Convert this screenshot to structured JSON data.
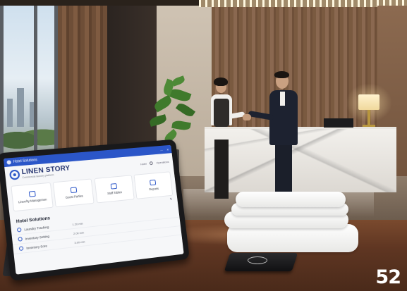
{
  "app": {
    "window_title": "Hotel Solutions",
    "brand": "LINEN STORY",
    "tagline": "Commercial laundry platform",
    "header_links": [
      "Hotel",
      "Operations"
    ]
  },
  "tiles": [
    {
      "label": "Linen/ity Managemen",
      "icon": "washer-icon"
    },
    {
      "label": "Guest Parties",
      "icon": "cart-icon"
    },
    {
      "label": "Staff Tables",
      "icon": "people-icon"
    },
    {
      "label": "Reports",
      "icon": "chart-icon"
    }
  ],
  "section_title": "Hotel Solutions",
  "solutions": [
    {
      "label": "Laundry Tracking",
      "value": "1.20 min",
      "icon": "truck-icon"
    },
    {
      "label": "Inventory Setting",
      "value": "2.00 min",
      "icon": "gear-icon"
    },
    {
      "label": "Inventory Sore",
      "value": "3.00 min",
      "icon": "box-icon"
    }
  ],
  "page_number": "52",
  "colors": {
    "accent": "#2b56c8",
    "brand_text": "#23326e"
  }
}
